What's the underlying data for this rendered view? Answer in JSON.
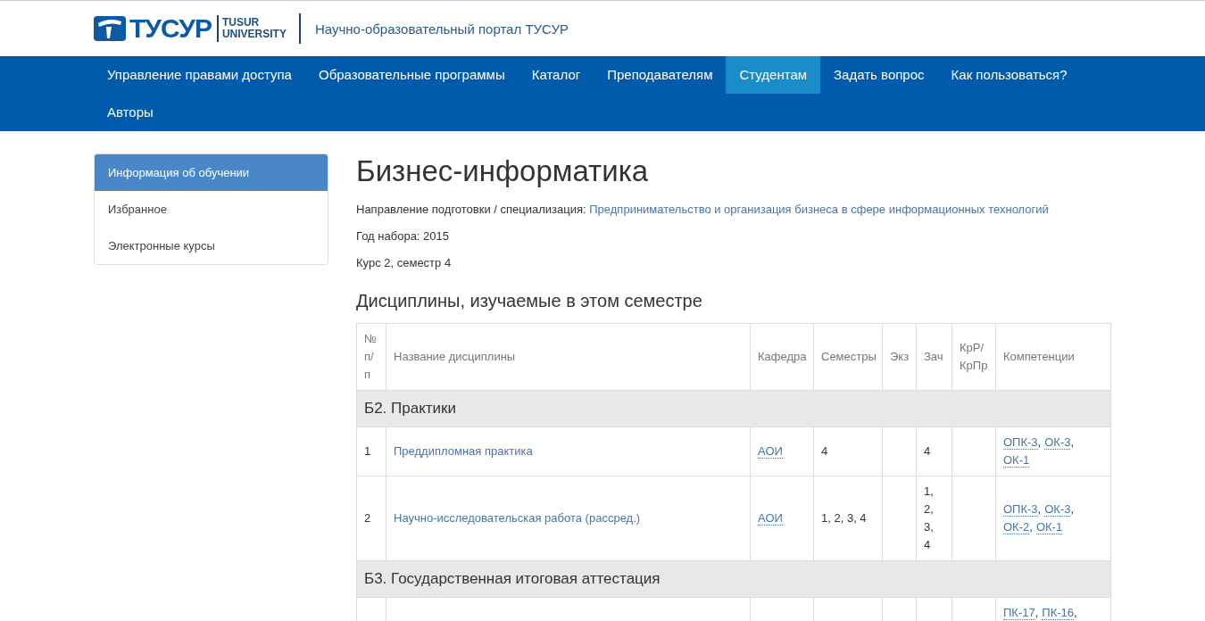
{
  "header": {
    "logo_text": "ТУСУР",
    "logo_sub_1": "TUSUR",
    "logo_sub_2": "UNIVERSITY",
    "portal_title": "Научно-образовательный портал ТУСУР"
  },
  "nav": [
    {
      "label": "Управление правами доступа",
      "selected": false
    },
    {
      "label": "Образовательные программы",
      "selected": false
    },
    {
      "label": "Каталог",
      "selected": false
    },
    {
      "label": "Преподавателям",
      "selected": false
    },
    {
      "label": "Студентам",
      "selected": true
    },
    {
      "label": "Задать вопрос",
      "selected": false
    },
    {
      "label": "Как пользоваться?",
      "selected": false
    },
    {
      "label": "Авторы",
      "selected": false
    }
  ],
  "sidebar": {
    "items": [
      {
        "label": "Информация об обучении",
        "selected": true
      },
      {
        "label": "Избранное",
        "selected": false
      },
      {
        "label": "Электронные курсы",
        "selected": false
      }
    ]
  },
  "page": {
    "title": "Бизнес-информатика",
    "direction_label": "Направление подготовки / специализация:",
    "direction_link": "Предпринимательство и организация бизнеса в сфере информационных технологий",
    "year": "Год набора: 2015",
    "course": "Курс 2, семестр 4",
    "section_title": "Дисциплины, изучаемые в этом семестре"
  },
  "table": {
    "columns": [
      "№ п/п",
      "Название дисциплины",
      "Кафедра",
      "Семестры",
      "Экз",
      "Зач",
      "КрР/ КрПр",
      "Компетенции"
    ],
    "sections": [
      {
        "title": "Б2. Практики",
        "rows": [
          {
            "num": "1",
            "name": "Преддипломная практика",
            "department": "АОИ",
            "semesters": "4",
            "credit": "4",
            "competencies": [
              {
                "code": "ОПК-3",
                "suffix": ","
              },
              {
                "code": "ОК-3",
                "suffix": ","
              },
              {
                "code": "ОК-1"
              }
            ]
          },
          {
            "num": "2",
            "name": "Научно-исследовательская работа (рассред.)",
            "department": "АОИ",
            "semesters": "1, 2, 3, 4",
            "credit": "1, 2, 3, 4",
            "competencies": [
              {
                "code": "ОПК-3",
                "suffix": ","
              },
              {
                "code": "ОК-3",
                "suffix": ","
              },
              {
                "code": "ОК-2",
                "suffix": ","
              },
              {
                "code": "ОК-1"
              }
            ]
          }
        ]
      },
      {
        "title": "Б3. Государственная итоговая аттестация",
        "rows": [
          {
            "competencies": [
              {
                "code": "ПК-17",
                "suffix": ","
              },
              {
                "code": "ПК-16",
                "suffix": ","
              }
            ]
          }
        ]
      }
    ]
  }
}
